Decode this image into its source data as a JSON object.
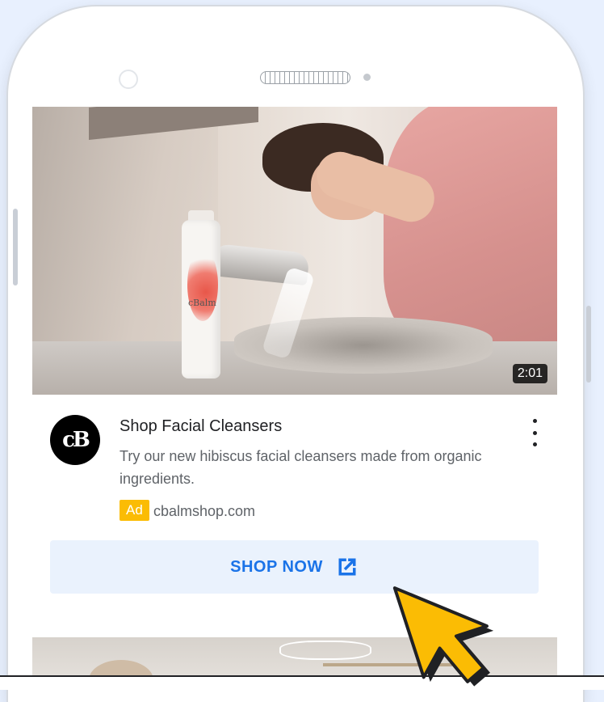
{
  "video": {
    "duration": "2:01",
    "bottle_brand": "cBalm"
  },
  "ad": {
    "avatar_text": "cB",
    "title": "Shop Facial Cleansers",
    "description": "Try our new hibiscus facial cleansers made from organic ingredients.",
    "badge": "Ad",
    "domain": "cbalmshop.com",
    "cta_label": "SHOP NOW"
  },
  "colors": {
    "accent": "#1a73e8",
    "badge": "#fbbc04",
    "cta_background": "#eaf2fd",
    "cursor": "#fbbc04"
  },
  "icons": [
    "more-vert-icon",
    "open-in-new-icon",
    "mouse-pointer-icon"
  ]
}
